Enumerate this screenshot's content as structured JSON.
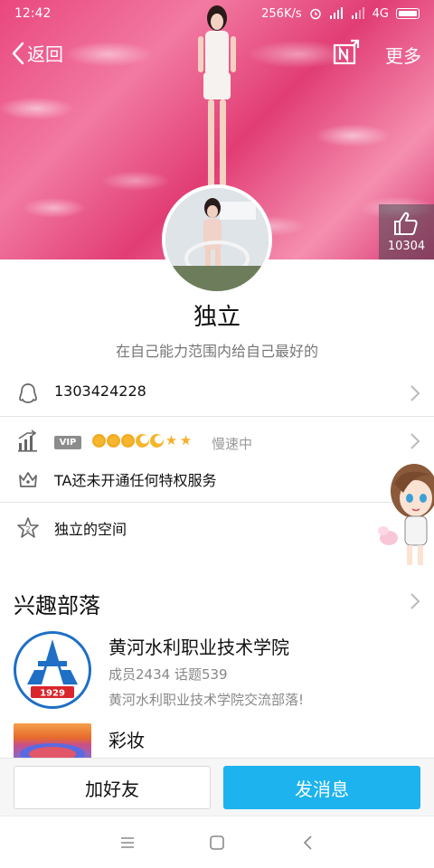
{
  "status_bar": {
    "time": "12:42",
    "network_speed": "256K/s",
    "network_type": "4G"
  },
  "nav": {
    "back_label": "返回",
    "more_label": "更多"
  },
  "cover": {
    "like_count": "10304"
  },
  "profile": {
    "nickname": "独立",
    "signature": "在自己能力范围内给自己最好的"
  },
  "info_rows": {
    "qq_number": "1303424228",
    "vip_badge": "VIP",
    "speed_status": "慢速中",
    "privilege_text": "TA还未开通任何特权服务",
    "space_text": "独立的空间"
  },
  "tribes": {
    "section_title": "兴趣部落",
    "items": [
      {
        "name": "黄河水利职业技术学院",
        "stats": "成员2434 话题539",
        "desc": "黄河水利职业技术学院交流部落!",
        "logo_year": "1929"
      },
      {
        "name": "彩妆"
      }
    ]
  },
  "bottom_actions": {
    "add_friend": "加好友",
    "send_message": "发消息"
  },
  "colors": {
    "accent": "#1cb3ef",
    "cover_pink": "#e9477e",
    "tribe_logo_blue": "#1e6fc5",
    "tribe_logo_red": "#d9262c"
  },
  "icons": [
    "back-chevron-icon",
    "theme-switch-icon",
    "thumbs-up-icon",
    "qq-penguin-icon",
    "level-chart-icon",
    "crown-icon",
    "star-space-icon",
    "chevron-right-icon",
    "menu-icon",
    "home-square-icon",
    "back-triangle-icon"
  ]
}
